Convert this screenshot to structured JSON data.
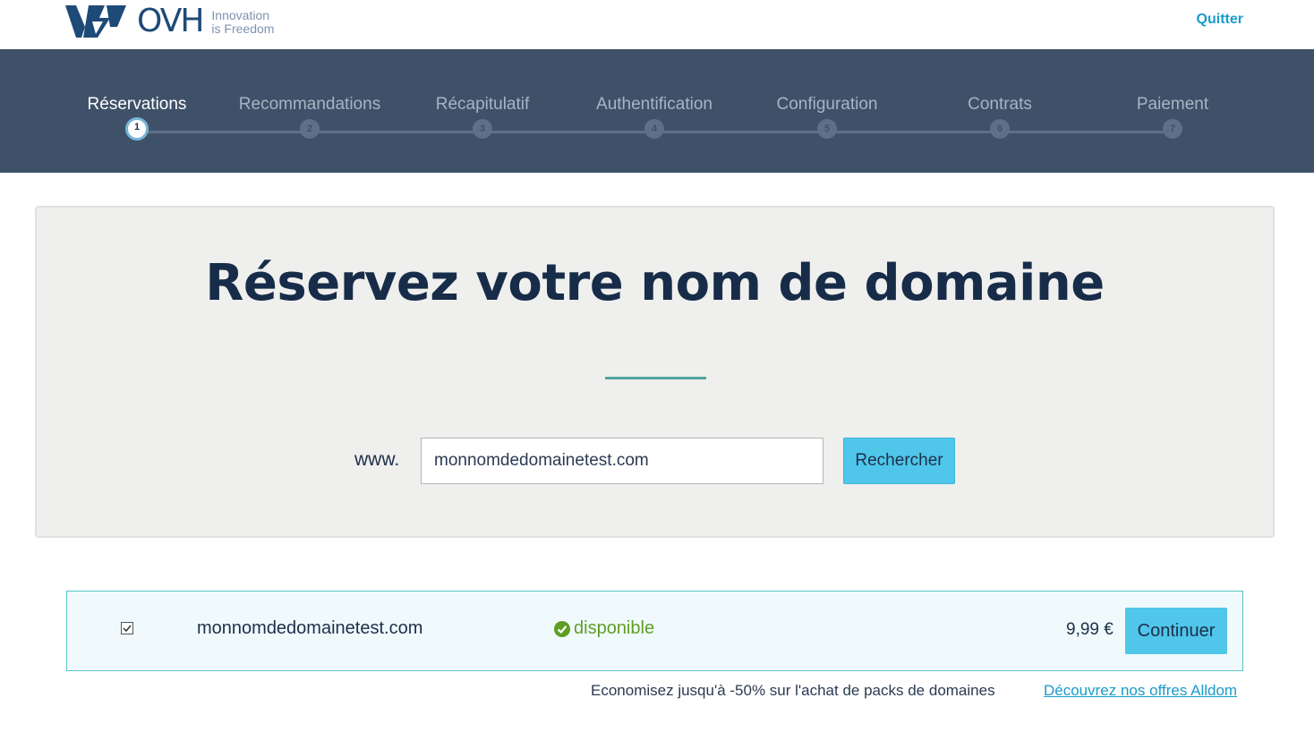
{
  "header": {
    "brand": "OVH",
    "tagline_line1": "Innovation",
    "tagline_line2": "is Freedom",
    "quit_label": "Quitter"
  },
  "steps": [
    {
      "label": "Réservations",
      "number": "1",
      "active": true
    },
    {
      "label": "Recommandations",
      "number": "2",
      "active": false
    },
    {
      "label": "Récapitulatif",
      "number": "3",
      "active": false
    },
    {
      "label": "Authentification",
      "number": "4",
      "active": false
    },
    {
      "label": "Configuration",
      "number": "5",
      "active": false
    },
    {
      "label": "Contrats",
      "number": "6",
      "active": false
    },
    {
      "label": "Paiement",
      "number": "7",
      "active": false
    }
  ],
  "search": {
    "title": "Réservez votre nom de domaine",
    "prefix": "www.",
    "value": "monnomdedomainetest.com",
    "button_label": "Rechercher"
  },
  "result": {
    "checked": true,
    "domain": "monnomdedomainetest.com",
    "status": "disponible",
    "price": "9,99 €",
    "continue_label": "Continuer"
  },
  "promo": {
    "text": "Economisez jusqu'à -50% sur l'achat de packs de domaines",
    "link_label": "Découvrez nos offres Alldom"
  },
  "colors": {
    "band": "#3f5168",
    "accent": "#4fc6ea",
    "link": "#1a9bc8",
    "available": "#5f9e23"
  }
}
